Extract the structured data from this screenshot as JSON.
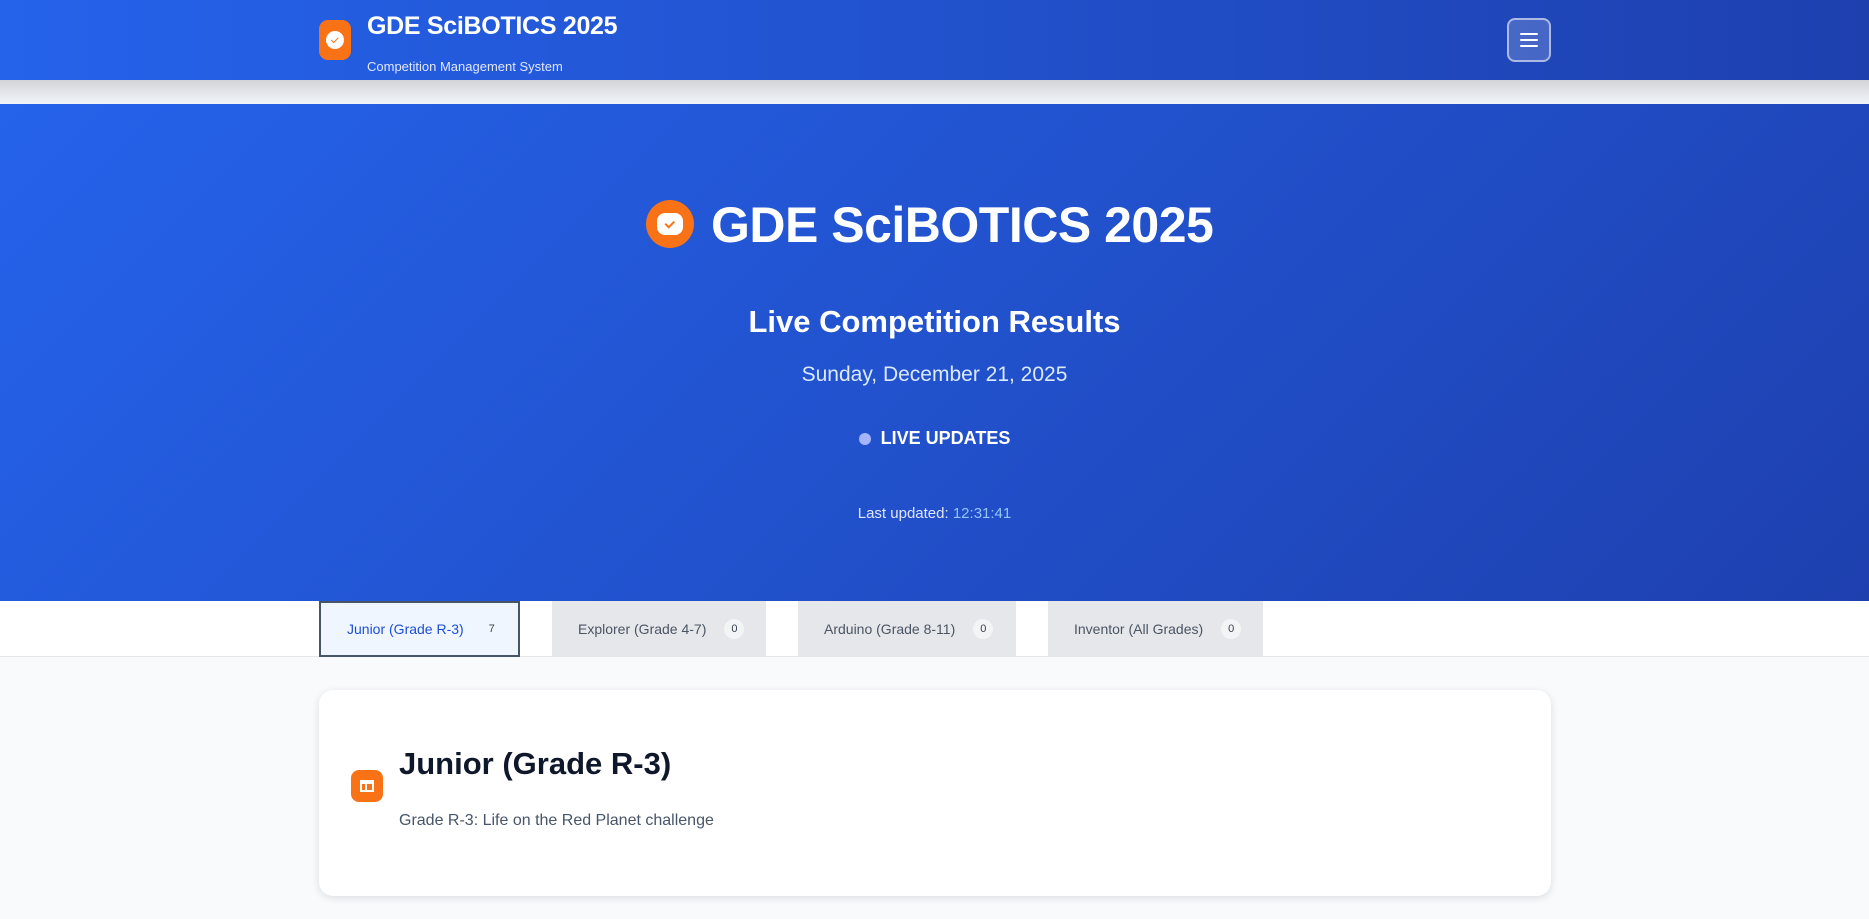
{
  "header": {
    "brand_title": "GDE SciBOTICS 2025",
    "brand_subtitle": "Competition Management System",
    "logo_icon": "robot-icon",
    "menu_icon": "hamburger-menu-icon"
  },
  "hero": {
    "title": "GDE SciBOTICS 2025",
    "subtitle": "Live Competition Results",
    "date": "Sunday, December 21, 2025",
    "live_label": "LIVE UPDATES",
    "last_updated_label": "Last updated:",
    "last_updated_time": "12:31:41"
  },
  "tabs": [
    {
      "label": "Junior (Grade R-3)",
      "count": "7",
      "active": true
    },
    {
      "label": "Explorer (Grade 4-7)",
      "count": "0",
      "active": false
    },
    {
      "label": "Arduino (Grade 8-11)",
      "count": "0",
      "active": false
    },
    {
      "label": "Inventor (All Grades)",
      "count": "0",
      "active": false
    }
  ],
  "category_card": {
    "title": "Junior (Grade R-3)",
    "description": "Grade R-3: Life on the Red Planet challenge",
    "icon": "category-icon"
  },
  "colors": {
    "primary": "#2563eb",
    "primary_dark": "#1e40af",
    "accent": "#f97316"
  }
}
